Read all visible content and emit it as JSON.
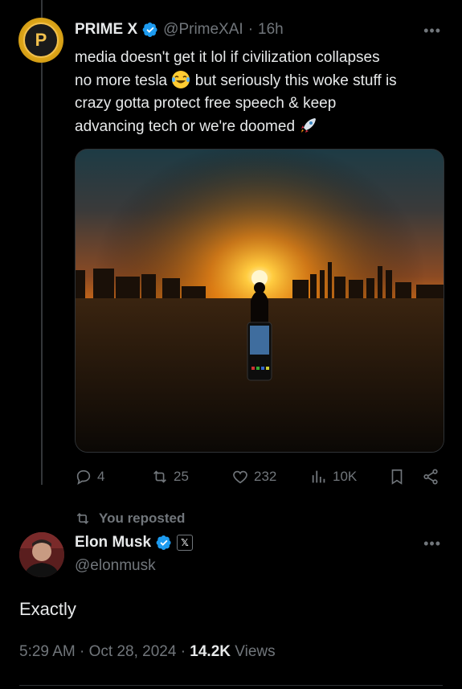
{
  "parent_tweet": {
    "display_name": "PRIME",
    "handle": "@PrimeXAI",
    "time": "16h",
    "separator": "·",
    "text_line1": "media doesn't get it lol if civilization collapses",
    "text_line2a": "no more tesla",
    "text_line2b": "but seriously this woke stuff is",
    "text_line3": "crazy gotta protect free speech & keep",
    "text_line4": "advancing tech or we're doomed",
    "emoji1": "laughing-tears-emoji",
    "emoji2": "rocket-emoji",
    "media_alt": "sunset-city-phone-image",
    "replies": "4",
    "reposts": "25",
    "likes": "232",
    "views": "10K"
  },
  "repost_banner": {
    "label": "You reposted"
  },
  "main_tweet": {
    "display_name": "Elon Musk",
    "handle": "@elonmusk",
    "badge": "𝕏",
    "text": "Exactly",
    "time": "5:29 AM",
    "dot": "·",
    "date": "Oct 28, 2024",
    "views_count": "14.2K",
    "views_label": "Views"
  },
  "colors": {
    "background": "#000000",
    "text": "#e7e9ea",
    "muted": "#71767b",
    "verified_blue": "#1d9bf0"
  }
}
